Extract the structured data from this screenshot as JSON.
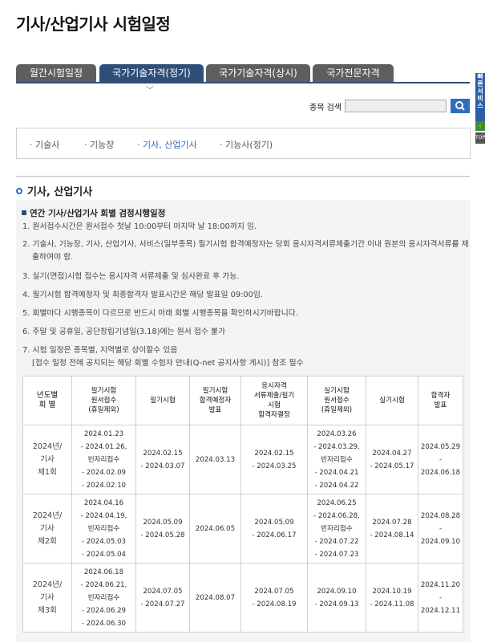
{
  "page": {
    "title": "기사/산업기사 시험일정"
  },
  "tabs": [
    {
      "label": "월간시험일정"
    },
    {
      "label": "국가기술자격(정기)"
    },
    {
      "label": "국가기술자격(상시)"
    },
    {
      "label": "국가전문자격"
    }
  ],
  "search": {
    "label": "종목 검색",
    "value": "",
    "button_icon": "search-icon"
  },
  "side_widget": {
    "label": "빠른서비스",
    "top_label": "TOP"
  },
  "subnav": [
    {
      "label": "· 기술사"
    },
    {
      "label": "· 기능장"
    },
    {
      "label": "· 기사, 산업기사"
    },
    {
      "label": "· 기능사(정기)"
    }
  ],
  "section": {
    "title": "기사, 산업기사"
  },
  "info": {
    "title": "연간 기사/산업기사 회별 검정시행일정",
    "notes": [
      {
        "n": "1.",
        "text": "원서접수시간은 원서접수 첫날 10:00부터 마지막 날 18:00까지 임."
      },
      {
        "n": "2.",
        "text": "기술사, 기능장, 기사, 산업기사, 서비스(일부종목) 필기시험 합격예정자는 당회 응시자격서류제출기간 이내 원본의 응시자격서류를 제출하여야 함."
      },
      {
        "n": "3.",
        "text": "실기(면접)시험 접수는 응시자격 서류제출 및 심사완료 후 가능."
      },
      {
        "n": "4.",
        "text": "필기시험 합격예정자 및 최종합격자 발표시간은 해당 발표일 09:00임."
      },
      {
        "n": "5.",
        "text": "회별마다 시행종목이 다르므로 반드시 아래 회별 시행종목을 확인하시기바랍니다."
      },
      {
        "n": "6.",
        "text": "주말 및 공휴일, 공단창립기념일(3.18)에는 원서 접수 불가"
      },
      {
        "n": "7.",
        "text": "시험 일정은 종목별, 지역별로 상이할수 있음"
      }
    ],
    "notes_extra": "[접수 일정 전에 공지되는 해당 회별 수험자 안내(Q-net 공지사항 게시)] 참조 필수"
  },
  "table": {
    "headers": [
      "년도별\n회 별",
      "필기시험\n원서접수\n(휴일제외)",
      "필기시험",
      "필기시험\n합격예정자\n발표",
      "응시자격\n서류제출/필기\n시험\n합격자결정",
      "실기시험\n원서접수\n(휴일제외)",
      "실기시험",
      "합격자\n발표"
    ],
    "rows": [
      [
        "2024년/\n기사\n제1회",
        "2024.01.23\n- 2024.01.26,\n빈자리접수\n- 2024.02.09\n- 2024.02.10",
        "2024.02.15\n- 2024.03.07",
        "2024.03.13",
        "2024.02.15\n- 2024.03.25",
        "2024.03.26\n- 2024.03.29,\n빈자리접수\n- 2024.04.21\n- 2024.04.22",
        "2024.04.27\n- 2024.05.17",
        "2024.05.29\n- 2024.06.18"
      ],
      [
        "2024년/\n기사\n제2회",
        "2024.04.16\n- 2024.04.19,\n빈자리접수\n- 2024.05.03\n- 2024.05.04",
        "2024.05.09\n- 2024.05.28",
        "2024.06.05",
        "2024.05.09\n- 2024.06.17",
        "2024.06.25\n- 2024.06.28,\n빈자리접수\n- 2024.07.22\n- 2024.07.23",
        "2024.07.28\n- 2024.08.14",
        "2024.08.28\n- 2024.09.10"
      ],
      [
        "2024년/\n기사\n제3회",
        "2024.06.18\n- 2024.06.21,\n빈자리접수\n- 2024.06.29\n- 2024.06.30",
        "2024.07.05\n- 2024.07.27",
        "2024.08.07",
        "2024.07.05\n- 2024.08.19",
        "2024.09.10\n- 2024.09.13",
        "2024.10.19\n- 2024.11.08",
        "2024.11.20\n- 2024.12.11"
      ]
    ]
  },
  "colors": {
    "tab_active": "#2f4f79",
    "tab_inactive": "#5e5e5e",
    "accent": "#2f6ebc"
  }
}
